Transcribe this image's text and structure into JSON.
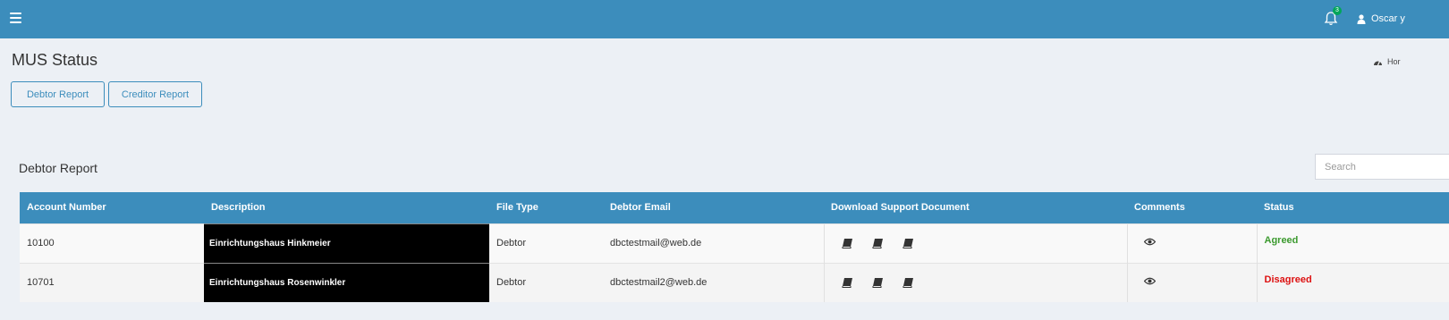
{
  "header": {
    "menu_icon": "hamburger-icon",
    "notification_count": "3",
    "user_name": "Oscar y"
  },
  "page": {
    "title": "MUS Status",
    "breadcrumb_home": "Hor"
  },
  "buttons": {
    "debtor_report": "Debtor Report",
    "creditor_report": "Creditor Report"
  },
  "section": {
    "title": "Debtor Report",
    "search_placeholder": "Search"
  },
  "table": {
    "columns": [
      "Account Number",
      "Description",
      "File Type",
      "Debtor Email",
      "Download Support Document",
      "Comments",
      "Status"
    ],
    "rows": [
      {
        "account": "10100",
        "description": "Einrichtungshaus Hinkmeier",
        "file_type": "Debtor",
        "email": "dbctestmail@web.de",
        "status": "Agreed",
        "status_color": "#3c9a2f"
      },
      {
        "account": "10701",
        "description": "Einrichtungshaus Rosenwinkler",
        "file_type": "Debtor",
        "email": "dbctestmail2@web.de",
        "status": "Disagreed",
        "status_color": "#dd1111"
      }
    ]
  },
  "colors": {
    "primary": "#3c8dbc",
    "background": "#ecf0f5",
    "success": "#3c9a2f",
    "danger": "#dd1111"
  },
  "icons": {
    "document": "book-icon",
    "comment": "eye-icon",
    "notifications": "bell-icon",
    "user": "user-icon",
    "home": "dashboard-icon"
  }
}
